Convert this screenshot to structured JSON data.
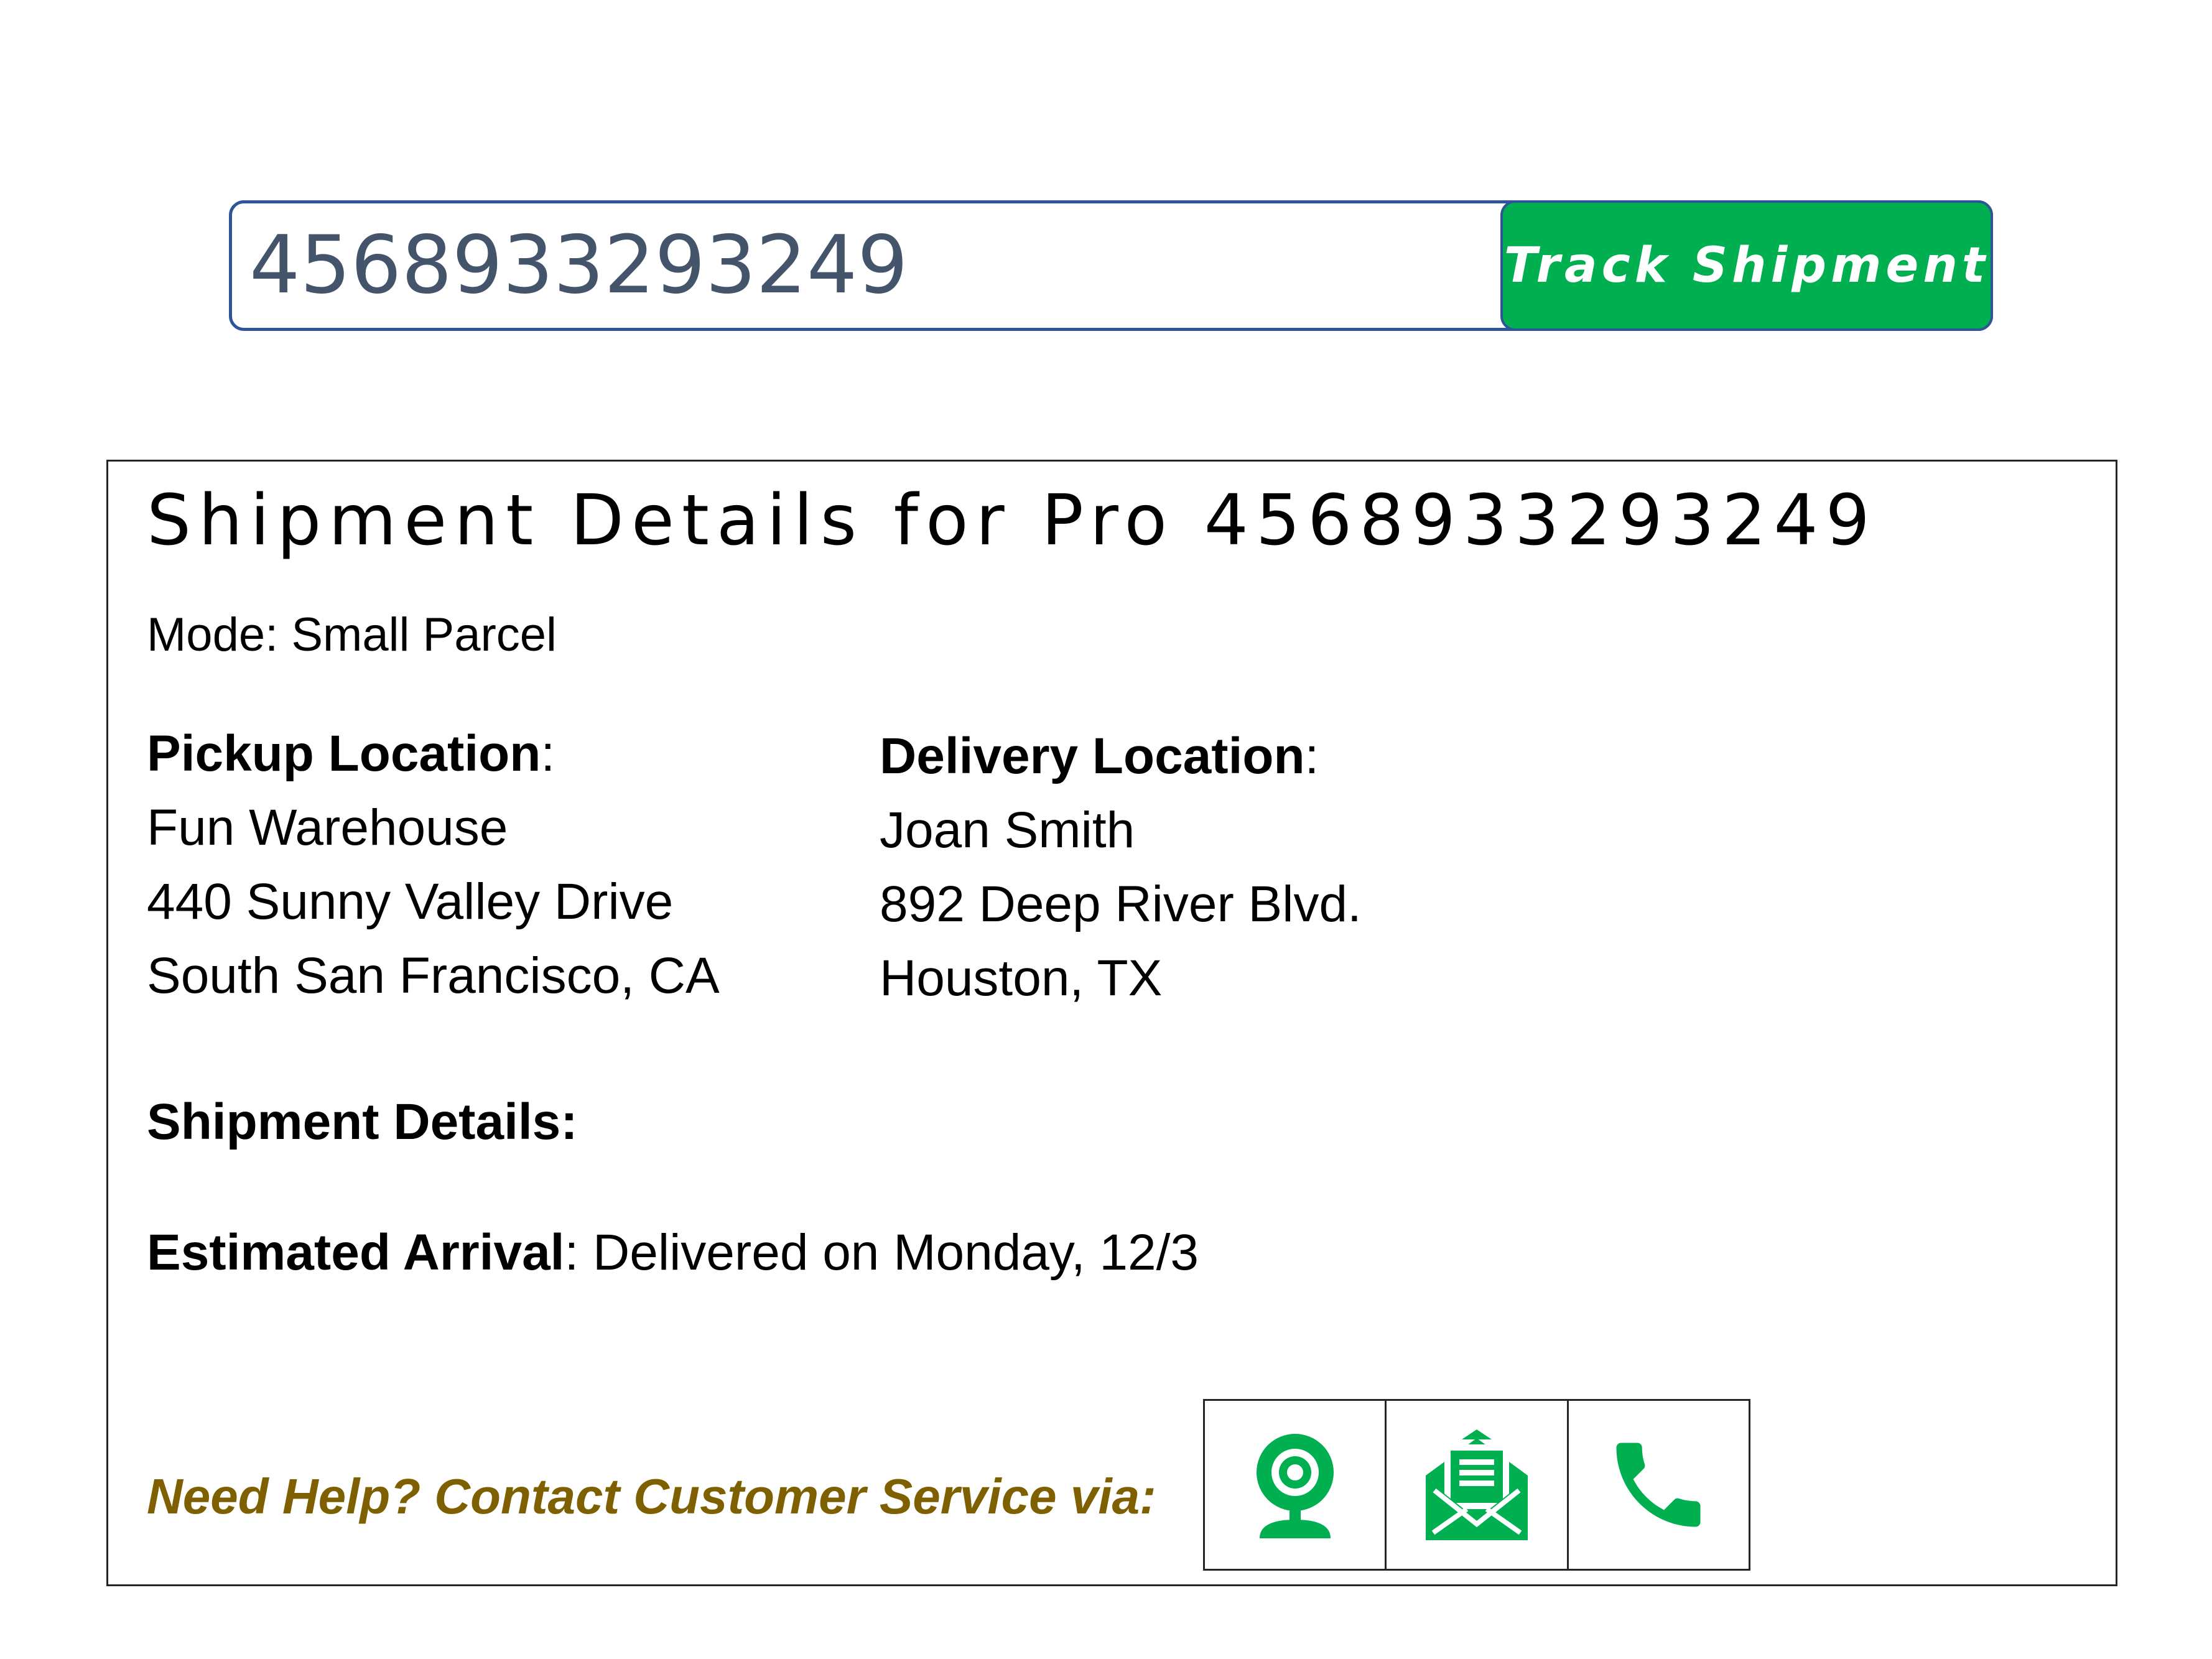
{
  "colors": {
    "accent_green": "#00b050",
    "border_blue": "#2f5597",
    "input_text": "#44546a",
    "help_text": "#7f6000"
  },
  "tracking": {
    "input_value": "4568933293249",
    "button_label": "Track Shipment"
  },
  "details": {
    "title": "Shipment Details for Pro 4568933293249",
    "mode_label": "Mode: ",
    "mode_value": "Small Parcel",
    "pickup": {
      "heading": "Pickup Location",
      "name": "Fun Warehouse",
      "street": "440 Sunny Valley Drive",
      "city": "South San Francisco, CA"
    },
    "delivery": {
      "heading": "Delivery Location",
      "name": "Joan Smith",
      "street": "892 Deep River Blvd.",
      "city": "Houston, TX"
    },
    "shipment_details_label": "Shipment Details:",
    "eta_label": "Estimated Arrival",
    "eta_value": "Delivered on Monday, 12/3"
  },
  "help": {
    "text": "Need Help? Contact Customer Service via:",
    "channels": [
      {
        "icon": "webcam-icon"
      },
      {
        "icon": "envelope-icon"
      },
      {
        "icon": "phone-icon"
      }
    ]
  }
}
